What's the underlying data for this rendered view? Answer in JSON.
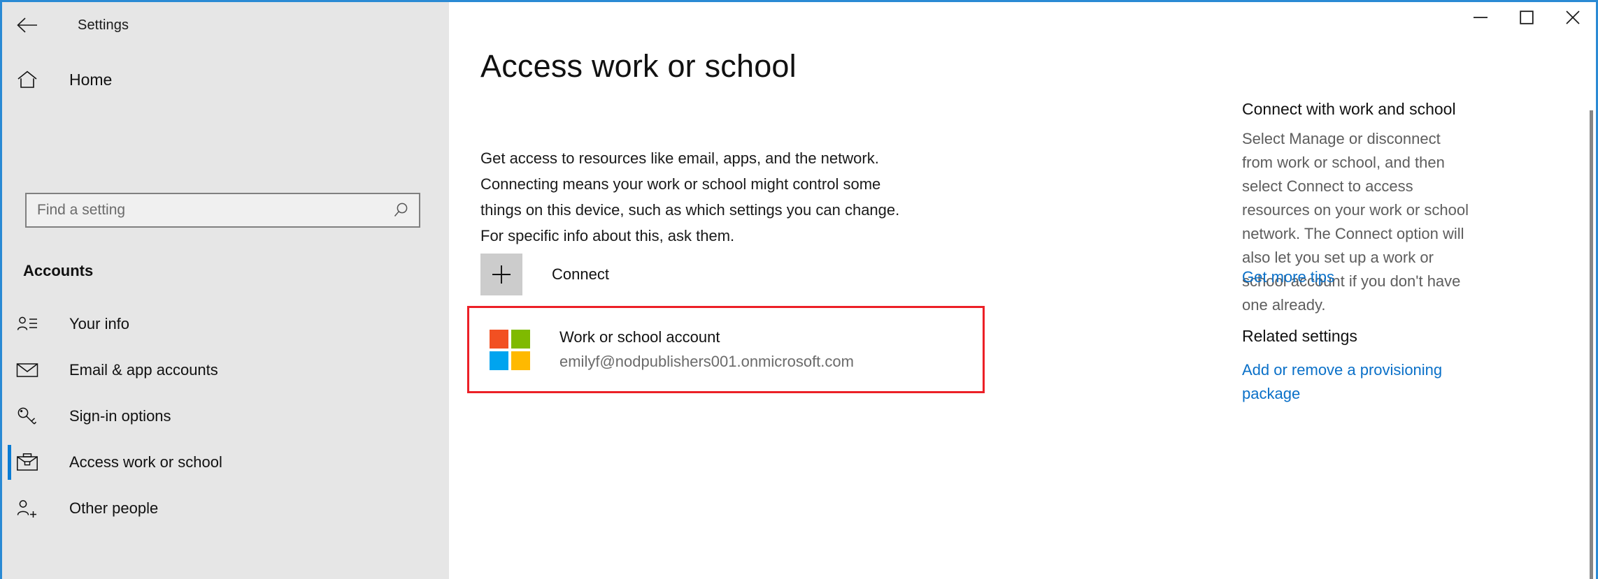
{
  "window": {
    "title": "Settings",
    "back_icon": "back-arrow-icon",
    "minimize_label": "─",
    "maximize_label": "□",
    "close_label": "✕"
  },
  "sidebar": {
    "home_label": "Home",
    "home_icon": "home-icon",
    "search": {
      "placeholder": "Find a setting",
      "value": "",
      "icon": "search-icon"
    },
    "category": "Accounts",
    "items": [
      {
        "label": "Your info",
        "icon": "user-info-icon",
        "selected": false
      },
      {
        "label": "Email & app accounts",
        "icon": "envelope-icon",
        "selected": false
      },
      {
        "label": "Sign-in options",
        "icon": "key-icon",
        "selected": false
      },
      {
        "label": "Access work or school",
        "icon": "briefcase-icon",
        "selected": true
      },
      {
        "label": "Other people",
        "icon": "add-user-icon",
        "selected": false
      }
    ]
  },
  "main": {
    "page_title": "Access work or school",
    "intro": "Get access to resources like email, apps, and the network. Connecting means your work or school might control some things on this device, such as which settings you can change. For specific info about this, ask them.",
    "connect": {
      "label": "Connect",
      "icon": "plus-icon"
    },
    "account": {
      "name": "Work or school account",
      "email": "emilyf@nodpublishers001.onmicrosoft.com",
      "logo_icon": "microsoft-logo-icon",
      "highlight_color": "#ec2027"
    }
  },
  "rail": {
    "connect_heading": "Connect with work and school",
    "connect_body": "Select Manage or disconnect from work or school, and then select Connect to access resources on your work or school network. The Connect option will also let you set up a work or school account if you don't have one already.",
    "tips_link": "Get more tips",
    "related_heading": "Related settings",
    "provisioning_link": "Add or remove a provisioning package"
  },
  "colors": {
    "window_border": "#2a8ad4",
    "sidebar_bg": "#e6e6e6",
    "accent_blue": "#0a7cd4",
    "link_blue": "#0a70c8",
    "ms_red": "#f25022",
    "ms_green": "#7fba00",
    "ms_blue": "#00a4ef",
    "ms_yellow": "#ffb900"
  }
}
